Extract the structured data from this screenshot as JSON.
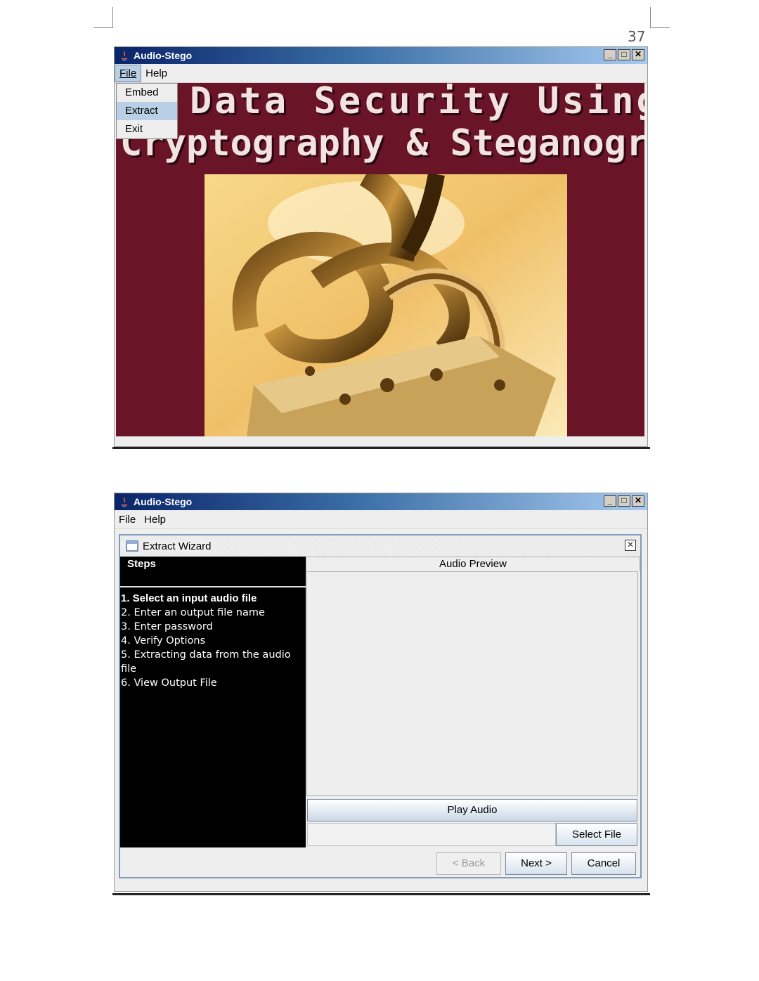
{
  "page": {
    "number": "37"
  },
  "window1": {
    "title": "Audio-Stego",
    "menu": {
      "file": "File",
      "help": "Help"
    },
    "file_menu_items": [
      "Embed",
      "Extract",
      "Exit"
    ],
    "selected_item": "Extract",
    "banner": {
      "line1": "Data Security Using",
      "line2": "Cryptography & Steganography"
    }
  },
  "window2": {
    "title": "Audio-Stego",
    "menu": {
      "file": "File",
      "help": "Help"
    },
    "wizard": {
      "title": "Extract Wizard",
      "steps_header": "Steps",
      "steps": [
        "1. Select an input audio file",
        "2. Enter an output file name",
        "3. Enter password",
        "4. Verify Options",
        "5. Extracting data from the audio file",
        "6. View Output File"
      ],
      "current_step": 0,
      "preview_header": "Audio Preview",
      "play_button": "Play Audio",
      "select_file_button": "Select File",
      "back_button": "< Back",
      "next_button": "Next >",
      "cancel_button": "Cancel"
    }
  },
  "colors": {
    "banner_bg": "#6a1428",
    "titlebar_start": "#0a246a",
    "titlebar_end": "#a6caf0",
    "menu_highlight": "#b8cfe5"
  },
  "icons": [
    "java-app-icon",
    "minimize-icon",
    "maximize-icon",
    "close-icon",
    "wizard-frame-icon",
    "frame-close-icon"
  ]
}
